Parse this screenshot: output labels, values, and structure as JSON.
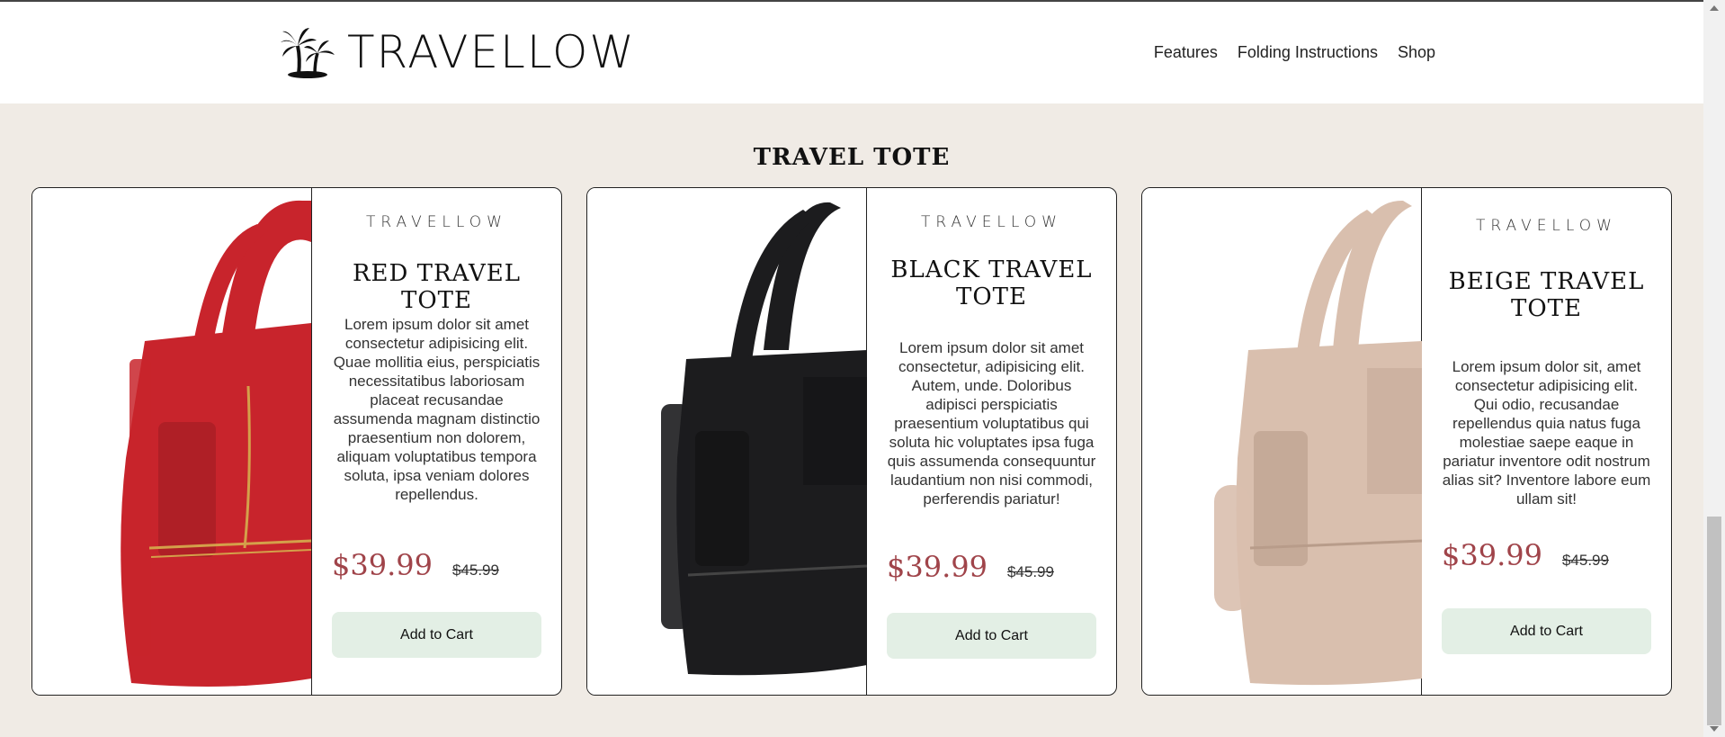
{
  "header": {
    "logo_text": "TRAVELLOW",
    "nav": [
      "Features",
      "Folding Instructions",
      "Shop"
    ]
  },
  "section": {
    "title": "TRAVEL TOTE"
  },
  "products": [
    {
      "brand": "TRAVELLOW",
      "title": "RED TRAVEL TOTE",
      "description": "Lorem ipsum dolor sit amet consectetur adipisicing elit. Quae mollitia eius, perspiciatis necessitatibus laboriosam placeat recusandae assumenda magnam distinctio praesentium non dolorem, aliquam voluptatibus tempora soluta, ipsa veniam dolores repellendus.",
      "price": "$39.99",
      "old_price": "$45.99",
      "button": "Add to Cart",
      "color": "#c8242c"
    },
    {
      "brand": "TRAVELLOW",
      "title": "BLACK TRAVEL TOTE",
      "description": "Lorem ipsum dolor sit amet consectetur, adipisicing elit. Autem, unde. Doloribus adipisci perspiciatis praesentium voluptatibus qui soluta hic voluptates ipsa fuga quis assumenda consequuntur laudantium non nisi commodi, perferendis pariatur!",
      "price": "$39.99",
      "old_price": "$45.99",
      "button": "Add to Cart",
      "color": "#1c1c1e"
    },
    {
      "brand": "TRAVELLOW",
      "title": "BEIGE TRAVEL TOTE",
      "description": "Lorem ipsum dolor sit, amet consectetur adipisicing elit. Qui odio, recusandae repellendus quia natus fuga molestiae saepe eaque in pariatur inventore odit nostrum alias sit? Inventore labore eum ullam sit!",
      "price": "$39.99",
      "old_price": "$45.99",
      "button": "Add to Cart",
      "color": "#d9bfae"
    }
  ],
  "colors": {
    "page_bg": "#f0ebe5",
    "price": "#a0444a",
    "button_bg": "#e3efe5"
  }
}
